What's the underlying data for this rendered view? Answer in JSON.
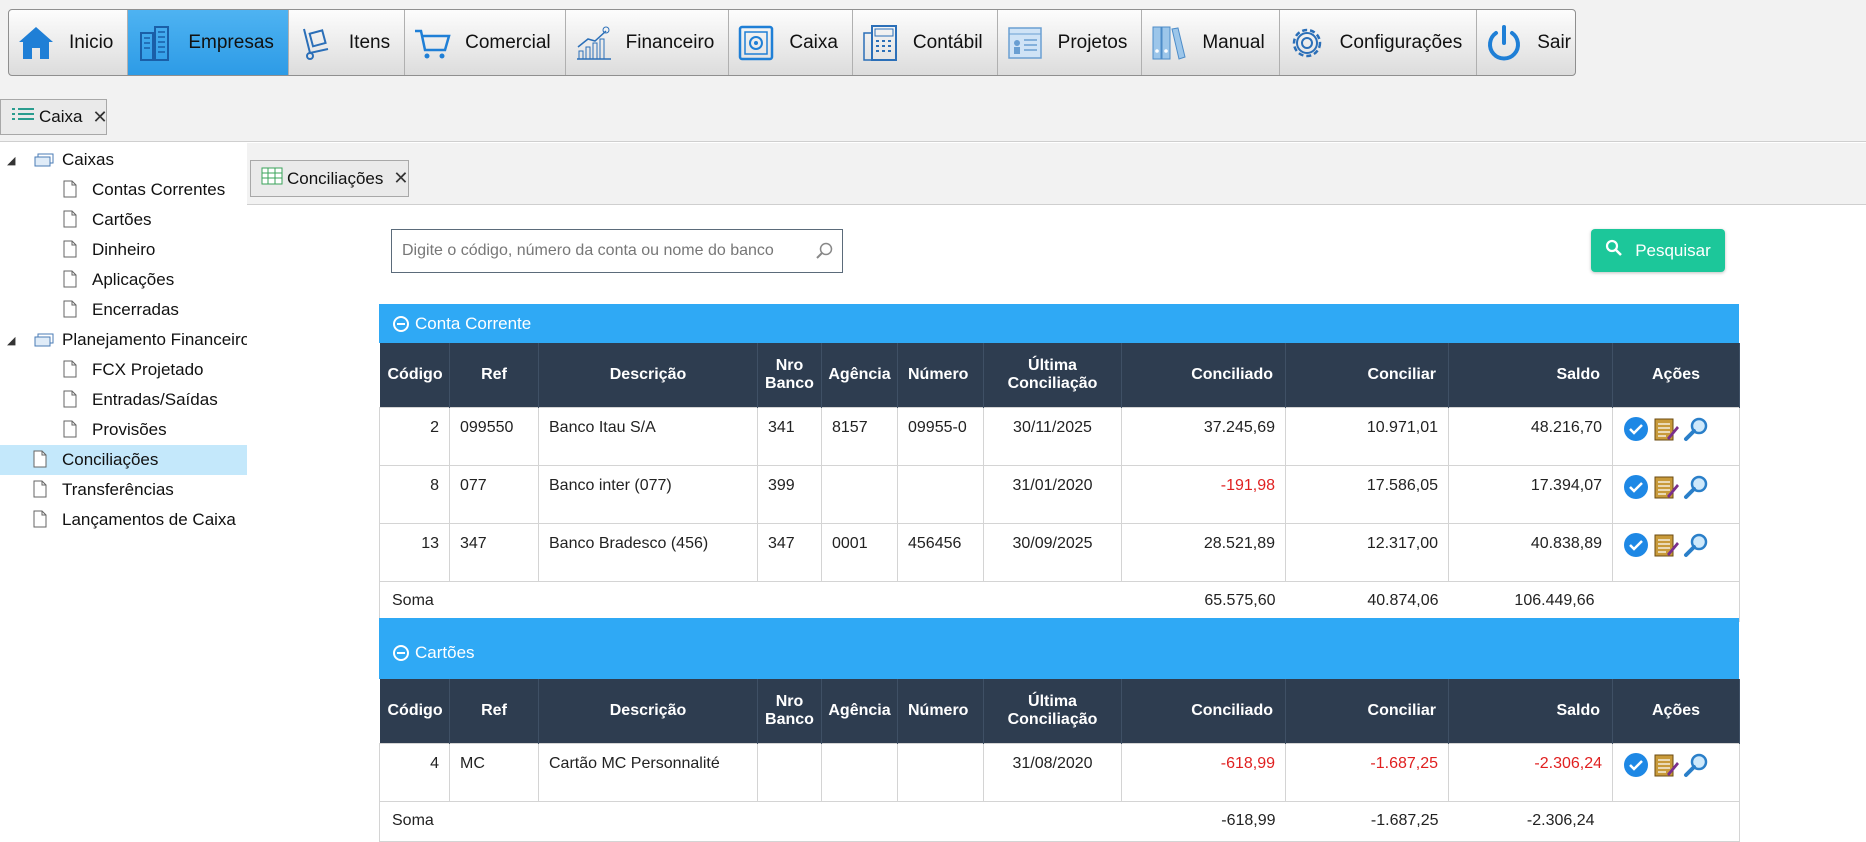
{
  "menu": {
    "items": [
      {
        "label": "Inicio",
        "icon": "home-icon"
      },
      {
        "label": "Empresas",
        "icon": "buildings-icon"
      },
      {
        "label": "Itens",
        "icon": "hand-truck-icon"
      },
      {
        "label": "Comercial",
        "icon": "shopping-cart-icon"
      },
      {
        "label": "Financeiro",
        "icon": "growth-chart-icon"
      },
      {
        "label": "Caixa",
        "icon": "safe-icon"
      },
      {
        "label": "Contábil",
        "icon": "calculator-icon"
      },
      {
        "label": "Projetos",
        "icon": "project-board-icon"
      },
      {
        "label": "Manual",
        "icon": "binders-icon"
      },
      {
        "label": "Configurações",
        "icon": "gear-icon"
      },
      {
        "label": "Sair",
        "icon": "power-icon"
      }
    ],
    "active": "Empresas"
  },
  "outer_tab": {
    "label": "Caixa",
    "close": "✕"
  },
  "inner_tab": {
    "label": "Conciliações",
    "close": "✕"
  },
  "tree": {
    "caixas": "Caixas",
    "contas_correntes": "Contas Correntes",
    "cartoes": "Cartões",
    "dinheiro": "Dinheiro",
    "aplicacoes": "Aplicações",
    "encerradas": "Encerradas",
    "planejamento": "Planejamento Financeiro",
    "fcx_projetado": "FCX Projetado",
    "entradas_saidas": "Entradas/Saídas",
    "provisoes": "Provisões",
    "conciliacoes": "Conciliações",
    "transferencias": "Transferências",
    "lancamentos": "Lançamentos de Caixa",
    "selected": "Conciliações"
  },
  "search": {
    "placeholder": "Digite o código, número da conta ou nome do banco",
    "value": "",
    "button_label": "Pesquisar"
  },
  "columns": {
    "codigo": "Código",
    "ref": "Ref",
    "descricao": "Descrição",
    "nro": "Nro",
    "banco": "Banco",
    "agencia": "Agência",
    "numero": "Número",
    "ultima": "Última",
    "conciliacao": "Conciliação",
    "conciliado": "Conciliado",
    "conciliar": "Conciliar",
    "saldo": "Saldo",
    "acoes": "Ações"
  },
  "sections": {
    "conta_corrente": {
      "title": "Conta Corrente",
      "rows": [
        {
          "codigo": "2",
          "ref": "099550",
          "descricao": "Banco Itau S/A",
          "nro_banco": "341",
          "agencia": "8157",
          "numero": "09955-0",
          "ultima": "30/11/2025",
          "conciliado": "37.245,69",
          "conciliar": "10.971,01",
          "saldo": "48.216,70"
        },
        {
          "codigo": "8",
          "ref": "077",
          "descricao": "Banco inter (077)",
          "nro_banco": "399",
          "agencia": "",
          "numero": "",
          "ultima": "31/01/2020",
          "conciliado": "-191,98",
          "conciliar": "17.586,05",
          "saldo": "17.394,07"
        },
        {
          "codigo": "13",
          "ref": "347",
          "descricao": "Banco Bradesco (456)",
          "nro_banco": "347",
          "agencia": "0001",
          "numero": "456456",
          "ultima": "30/09/2025",
          "conciliado": "28.521,89",
          "conciliar": "12.317,00",
          "saldo": "40.838,89"
        }
      ],
      "sum": {
        "label": "Soma",
        "conciliado": "65.575,60",
        "conciliar": "40.874,06",
        "saldo": "106.449,66"
      }
    },
    "cartoes": {
      "title": "Cartões",
      "rows": [
        {
          "codigo": "4",
          "ref": "MC",
          "descricao": "Cartão MC Personnalité",
          "nro_banco": "",
          "agencia": "",
          "numero": "",
          "ultima": "31/08/2020",
          "conciliado": "-618,99",
          "conciliar": "-1.687,25",
          "saldo": "-2.306,24"
        }
      ],
      "sum": {
        "label": "Soma",
        "conciliado": "-618,99",
        "conciliar": "-1.687,25",
        "saldo": "-2.306,24"
      }
    }
  },
  "colors": {
    "accent": "#2fa9f5",
    "header_dark": "#2e3d50",
    "button_green": "#1cc79a",
    "negative": "#e02020",
    "selected_row": "#c4e8fb"
  }
}
